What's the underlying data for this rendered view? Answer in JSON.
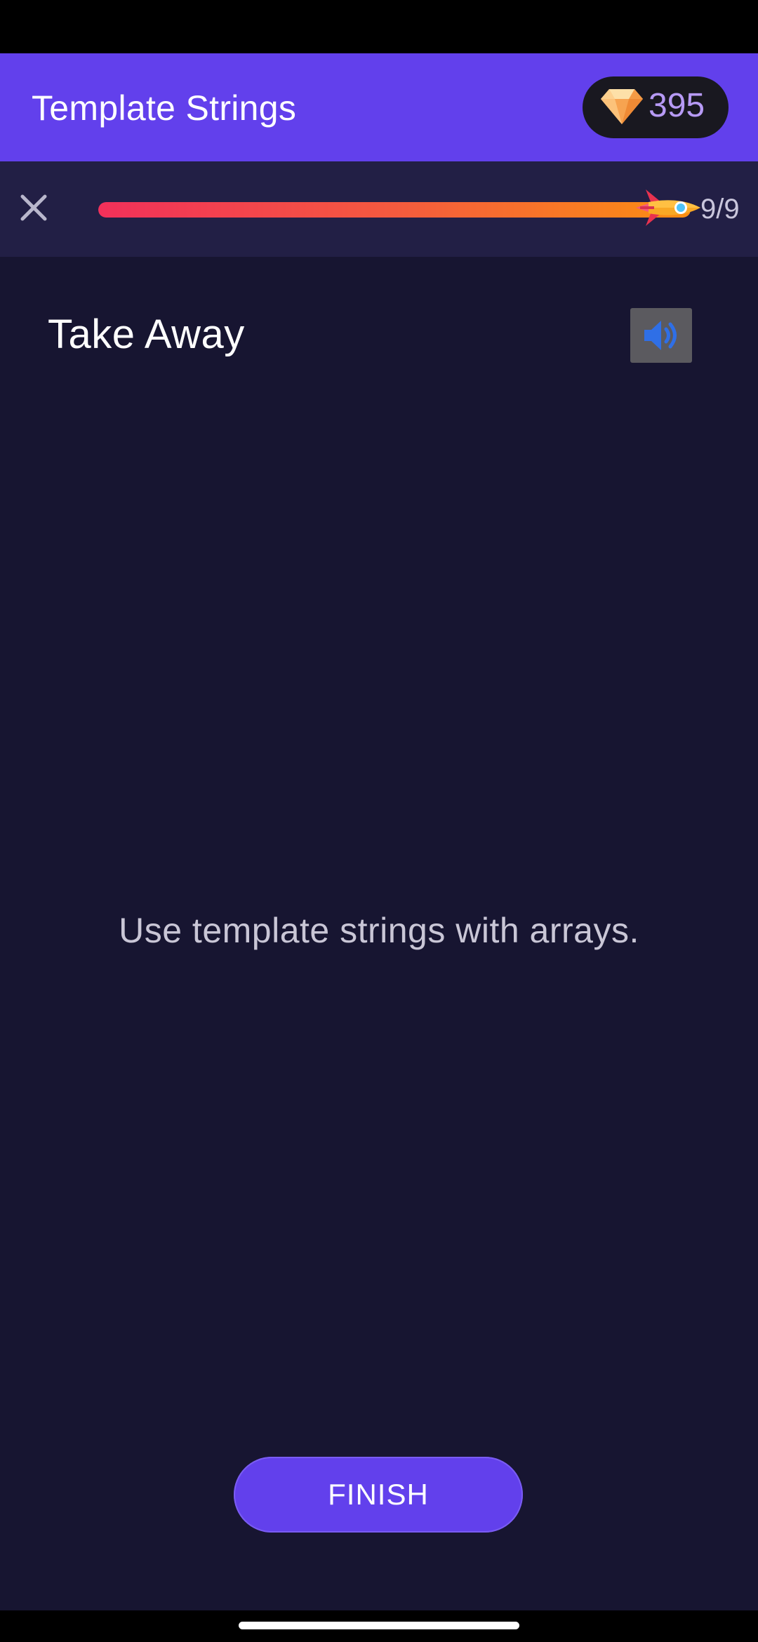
{
  "header": {
    "title": "Template Strings",
    "gems": "395",
    "gem_icon": "diamond-icon"
  },
  "progress": {
    "current": 9,
    "total": 9,
    "fraction": 1.0,
    "label": "9/9",
    "close_icon": "close-icon",
    "marker_icon": "rocket-icon"
  },
  "content": {
    "title": "Take Away",
    "audio_icon": "speaker-icon",
    "text": "Use template strings with arrays."
  },
  "footer": {
    "finish_label": "FINISH"
  },
  "colors": {
    "header_bg": "#6240ec",
    "page_bg": "#171531",
    "progress_bg": "#221f45",
    "progress_start": "#f2305a",
    "progress_end": "#fb8f12",
    "gem_count": "#b79af5",
    "speaker": "#2f6fe6"
  }
}
